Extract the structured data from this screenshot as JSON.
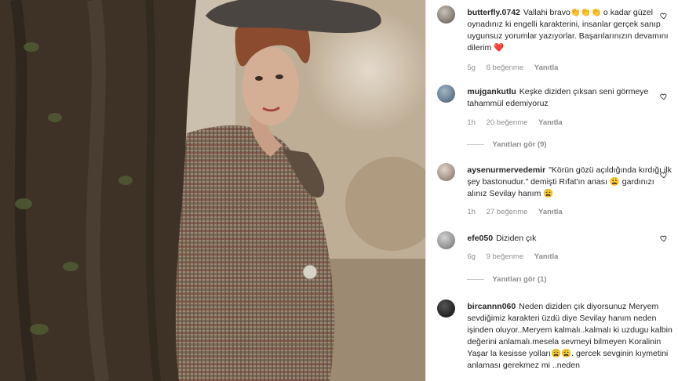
{
  "comments": [
    {
      "username": "butterfly.0742",
      "text": "Vallahi bravo👏👏👏 o kadar güzel oynadınız ki engelli karakterini, insanlar gerçek sanıp uygunsuz yorumlar yazıyorlar. Başarılarınızın devamını dilerim ❤️",
      "time": "5g",
      "likes": "6 beğenme",
      "reply": "Yanıtla"
    },
    {
      "username": "mujgankutlu",
      "text": "Keşke diziden çıksan seni görmeye tahammül edemiyoruz",
      "time": "1h",
      "likes": "20 beğenme",
      "reply": "Yanıtla",
      "view_replies": "Yanıtları gör (9)"
    },
    {
      "username": "aysenurmervedemir",
      "text": "\"Körün gözü açıldığında kırdığı ilk şey bastonudur.\" demişti Rıfat'ın anası 😩 gardınızı alınız Sevilay hanım 😩",
      "time": "1h",
      "likes": "27 beğenme",
      "reply": "Yanıtla"
    },
    {
      "username": "efe050",
      "text": "Diziden çık",
      "time": "6g",
      "likes": "9 beğenme",
      "reply": "Yanıtla",
      "view_replies": "Yanıtları gör (1)"
    },
    {
      "username": "bircannn060",
      "text": "Neden diziden çık diyorsunuz Meryem sevdiğimiz karakteri üzdü diye Sevilay hanım neden işinden oluyor..Meryem kalmalı..kalmalı ki uzdugu kalbin değerini anlamalı.mesela sevmeyi bilmeyen Koralinin Yaşar la kesisse yolları😩😩. gercek sevginin kıymetini anlaması gerekmez mi ..neden"
    }
  ],
  "icons": {
    "like": "heart-outline-icon"
  }
}
